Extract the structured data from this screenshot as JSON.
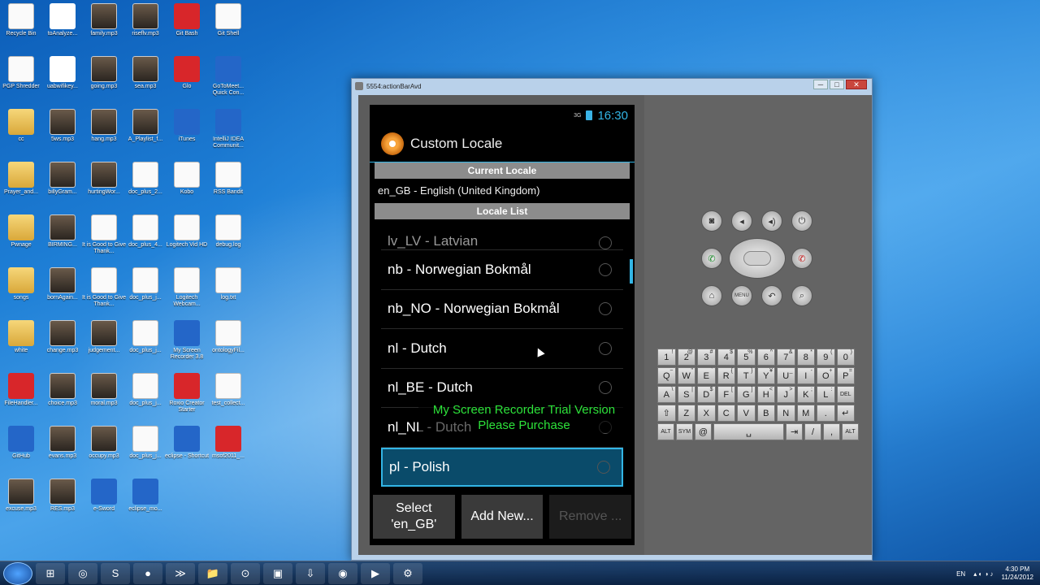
{
  "desktop": {
    "icons": [
      {
        "label": "Recycle Bin",
        "icon": "recycle-bin-icon",
        "kind": "blank"
      },
      {
        "label": "toAnalyze...",
        "icon": "word-doc-icon",
        "kind": "doc"
      },
      {
        "label": "family.mp3",
        "icon": "video-icon",
        "kind": "video"
      },
      {
        "label": "riseflv.mp3",
        "icon": "video-icon",
        "kind": "video"
      },
      {
        "label": "Git Bash",
        "icon": "git-bash-icon",
        "kind": "red"
      },
      {
        "label": "Git Shell",
        "icon": "git-shell-icon",
        "kind": "blank"
      },
      {
        "label": "PGP Shredder",
        "icon": "pgp-shredder-icon",
        "kind": "blank"
      },
      {
        "label": "uabwifikey...",
        "icon": "word-doc-icon",
        "kind": "doc"
      },
      {
        "label": "going.mp3",
        "icon": "video-icon",
        "kind": "video"
      },
      {
        "label": "sea.mp3",
        "icon": "video-icon",
        "kind": "video"
      },
      {
        "label": "Glo",
        "icon": "glo-icon",
        "kind": "red"
      },
      {
        "label": "GoToMeet... Quick Con...",
        "icon": "gotomeeting-icon",
        "kind": "blue"
      },
      {
        "label": "cc",
        "icon": "folder-icon",
        "kind": "folder"
      },
      {
        "label": "5ws.mp3",
        "icon": "video-icon",
        "kind": "video"
      },
      {
        "label": "hang.mp3",
        "icon": "video-icon",
        "kind": "video"
      },
      {
        "label": "A_Playlist_f...",
        "icon": "video-icon",
        "kind": "video"
      },
      {
        "label": "iTunes",
        "icon": "itunes-icon",
        "kind": "blue"
      },
      {
        "label": "IntelliJ IDEA Communit...",
        "icon": "intellij-icon",
        "kind": "blue"
      },
      {
        "label": "Prayer_and...",
        "icon": "folder-icon",
        "kind": "folder"
      },
      {
        "label": "billyGram...",
        "icon": "video-icon",
        "kind": "video"
      },
      {
        "label": "hurtingWor...",
        "icon": "video-icon",
        "kind": "video"
      },
      {
        "label": "doc_plus_2...",
        "icon": "doc-plus-icon",
        "kind": "blank"
      },
      {
        "label": "Kobo",
        "icon": "kobo-icon",
        "kind": "blank"
      },
      {
        "label": "RSS Bandit",
        "icon": "rss-bandit-icon",
        "kind": "blank"
      },
      {
        "label": "Pwnage",
        "icon": "folder-icon",
        "kind": "folder"
      },
      {
        "label": "BIRMING...",
        "icon": "video-icon",
        "kind": "video"
      },
      {
        "label": "It is Good to Give Thank...",
        "icon": "audio-icon",
        "kind": "blank"
      },
      {
        "label": "doc_plus_4...",
        "icon": "doc-plus-icon",
        "kind": "blank"
      },
      {
        "label": "Logitech Vid HD",
        "icon": "logitech-icon",
        "kind": "blank"
      },
      {
        "label": "debug.log",
        "icon": "text-file-icon",
        "kind": "blank"
      },
      {
        "label": "songs",
        "icon": "folder-icon",
        "kind": "folder"
      },
      {
        "label": "bornAgain...",
        "icon": "video-icon",
        "kind": "video"
      },
      {
        "label": "It is Good to Give Thank...",
        "icon": "audio-icon",
        "kind": "blank"
      },
      {
        "label": "doc_plus_j...",
        "icon": "doc-plus-icon",
        "kind": "blank"
      },
      {
        "label": "Logitech Webcam...",
        "icon": "webcam-icon",
        "kind": "blank"
      },
      {
        "label": "log.txt",
        "icon": "text-file-icon",
        "kind": "blank"
      },
      {
        "label": "white",
        "icon": "folder-icon",
        "kind": "folder"
      },
      {
        "label": "change.mp3",
        "icon": "video-icon",
        "kind": "video"
      },
      {
        "label": "judgement...",
        "icon": "video-icon",
        "kind": "video"
      },
      {
        "label": "doc_plus_j...",
        "icon": "doc-plus-icon",
        "kind": "blank"
      },
      {
        "label": "My Screen Recorder 3.8",
        "icon": "screen-recorder-icon",
        "kind": "blue"
      },
      {
        "label": "ontologyFil...",
        "icon": "text-file-icon",
        "kind": "blank"
      },
      {
        "label": "FileHandler...",
        "icon": "pdf-icon",
        "kind": "red"
      },
      {
        "label": "choice.mp3",
        "icon": "video-icon",
        "kind": "video"
      },
      {
        "label": "moral.mp3",
        "icon": "video-icon",
        "kind": "video"
      },
      {
        "label": "doc_plus_j...",
        "icon": "doc-plus-icon",
        "kind": "blank"
      },
      {
        "label": "Roxio Creator Starter",
        "icon": "roxio-icon",
        "kind": "red"
      },
      {
        "label": "test_collect...",
        "icon": "text-file-icon",
        "kind": "blank"
      },
      {
        "label": "GitHub",
        "icon": "github-icon",
        "kind": "blue"
      },
      {
        "label": "evans.mp3",
        "icon": "video-icon",
        "kind": "video"
      },
      {
        "label": "occupy.mp3",
        "icon": "video-icon",
        "kind": "video"
      },
      {
        "label": "doc_plus_j...",
        "icon": "doc-plus-icon",
        "kind": "blank"
      },
      {
        "label": "eclipse - Shortcut",
        "icon": "eclipse-icon",
        "kind": "blue"
      },
      {
        "label": "msof2011_...",
        "icon": "roxio-icon",
        "kind": "red"
      },
      {
        "label": "excuse.mp3",
        "icon": "video-icon",
        "kind": "video"
      },
      {
        "label": "RES.mp3",
        "icon": "video-icon",
        "kind": "video"
      },
      {
        "label": "e-Sword",
        "icon": "esword-icon",
        "kind": "blue"
      },
      {
        "label": "eclipse_mo...",
        "icon": "eclipse-icon",
        "kind": "blue"
      }
    ]
  },
  "window": {
    "title": "5554:actionBarAvd",
    "minimize": "─",
    "maximize": "□",
    "close": "✕"
  },
  "android": {
    "status": {
      "signal": "3G",
      "time": "16:30"
    },
    "app_title": "Custom Locale",
    "current_header": "Current Locale",
    "current_value": "en_GB - English (United Kingdom)",
    "list_header": "Locale List",
    "items": [
      {
        "label": "lv_LV - Latvian",
        "partial": true
      },
      {
        "label": "nb - Norwegian Bokmål"
      },
      {
        "label": "nb_NO - Norwegian Bokmål"
      },
      {
        "label": "nl - Dutch"
      },
      {
        "label": "nl_BE - Dutch"
      },
      {
        "label": "nl_NL - Dutch"
      },
      {
        "label": "pl - Polish",
        "selected": true
      }
    ],
    "watermark_line1": "My Screen Recorder Trial Version",
    "watermark_line2": "Please Purchase",
    "buttons": {
      "select": "Select 'en_GB'",
      "add": "Add New...",
      "remove": "Remove ..."
    }
  },
  "keyboard": {
    "row1": [
      [
        "1",
        "!"
      ],
      [
        "2",
        "@"
      ],
      [
        "3",
        "#"
      ],
      [
        "4",
        "$"
      ],
      [
        "5",
        "%"
      ],
      [
        "6",
        "^"
      ],
      [
        "7",
        "&"
      ],
      [
        "8",
        "*"
      ],
      [
        "9",
        "("
      ],
      [
        "0",
        ")"
      ]
    ],
    "row2": [
      [
        "Q",
        "~"
      ],
      [
        "W",
        "\""
      ],
      [
        "E",
        "`"
      ],
      [
        "R",
        "{"
      ],
      [
        "T",
        "}"
      ],
      [
        "Y",
        "¥"
      ],
      [
        "U",
        "_"
      ],
      [
        "I",
        "-"
      ],
      [
        "O",
        "+"
      ],
      [
        "P",
        "="
      ]
    ],
    "row3": [
      [
        "A",
        "\\"
      ],
      [
        "S",
        "|"
      ],
      [
        "D",
        "$"
      ],
      [
        "F",
        "["
      ],
      [
        "G",
        "]"
      ],
      [
        "H",
        "<"
      ],
      [
        "J",
        ">"
      ],
      [
        "K",
        ";"
      ],
      [
        "L",
        ":"
      ],
      [
        "DEL",
        ""
      ]
    ],
    "row4": [
      [
        "⇧",
        ""
      ],
      [
        "Z",
        ""
      ],
      [
        "X",
        ""
      ],
      [
        "C",
        ""
      ],
      [
        "V",
        ""
      ],
      [
        "B",
        ""
      ],
      [
        "N",
        ""
      ],
      [
        "M",
        ""
      ],
      [
        ".",
        ""
      ],
      [
        "↵",
        ""
      ]
    ],
    "row5": [
      [
        "ALT",
        ""
      ],
      [
        "SYM",
        ""
      ],
      [
        "@",
        ""
      ],
      [
        "␣",
        ""
      ],
      [
        "⇥",
        ""
      ],
      [
        "/",
        ""
      ],
      [
        ",",
        ""
      ],
      [
        "ALT",
        ""
      ]
    ]
  },
  "taskbar": {
    "apps": [
      "⊞",
      "◎",
      "S",
      "●",
      "≫",
      "📁",
      "⊙",
      "▣",
      "⇩",
      "◉",
      "▶",
      "⚙"
    ],
    "lang": "EN",
    "time": "4:30 PM",
    "date": "11/24/2012"
  }
}
